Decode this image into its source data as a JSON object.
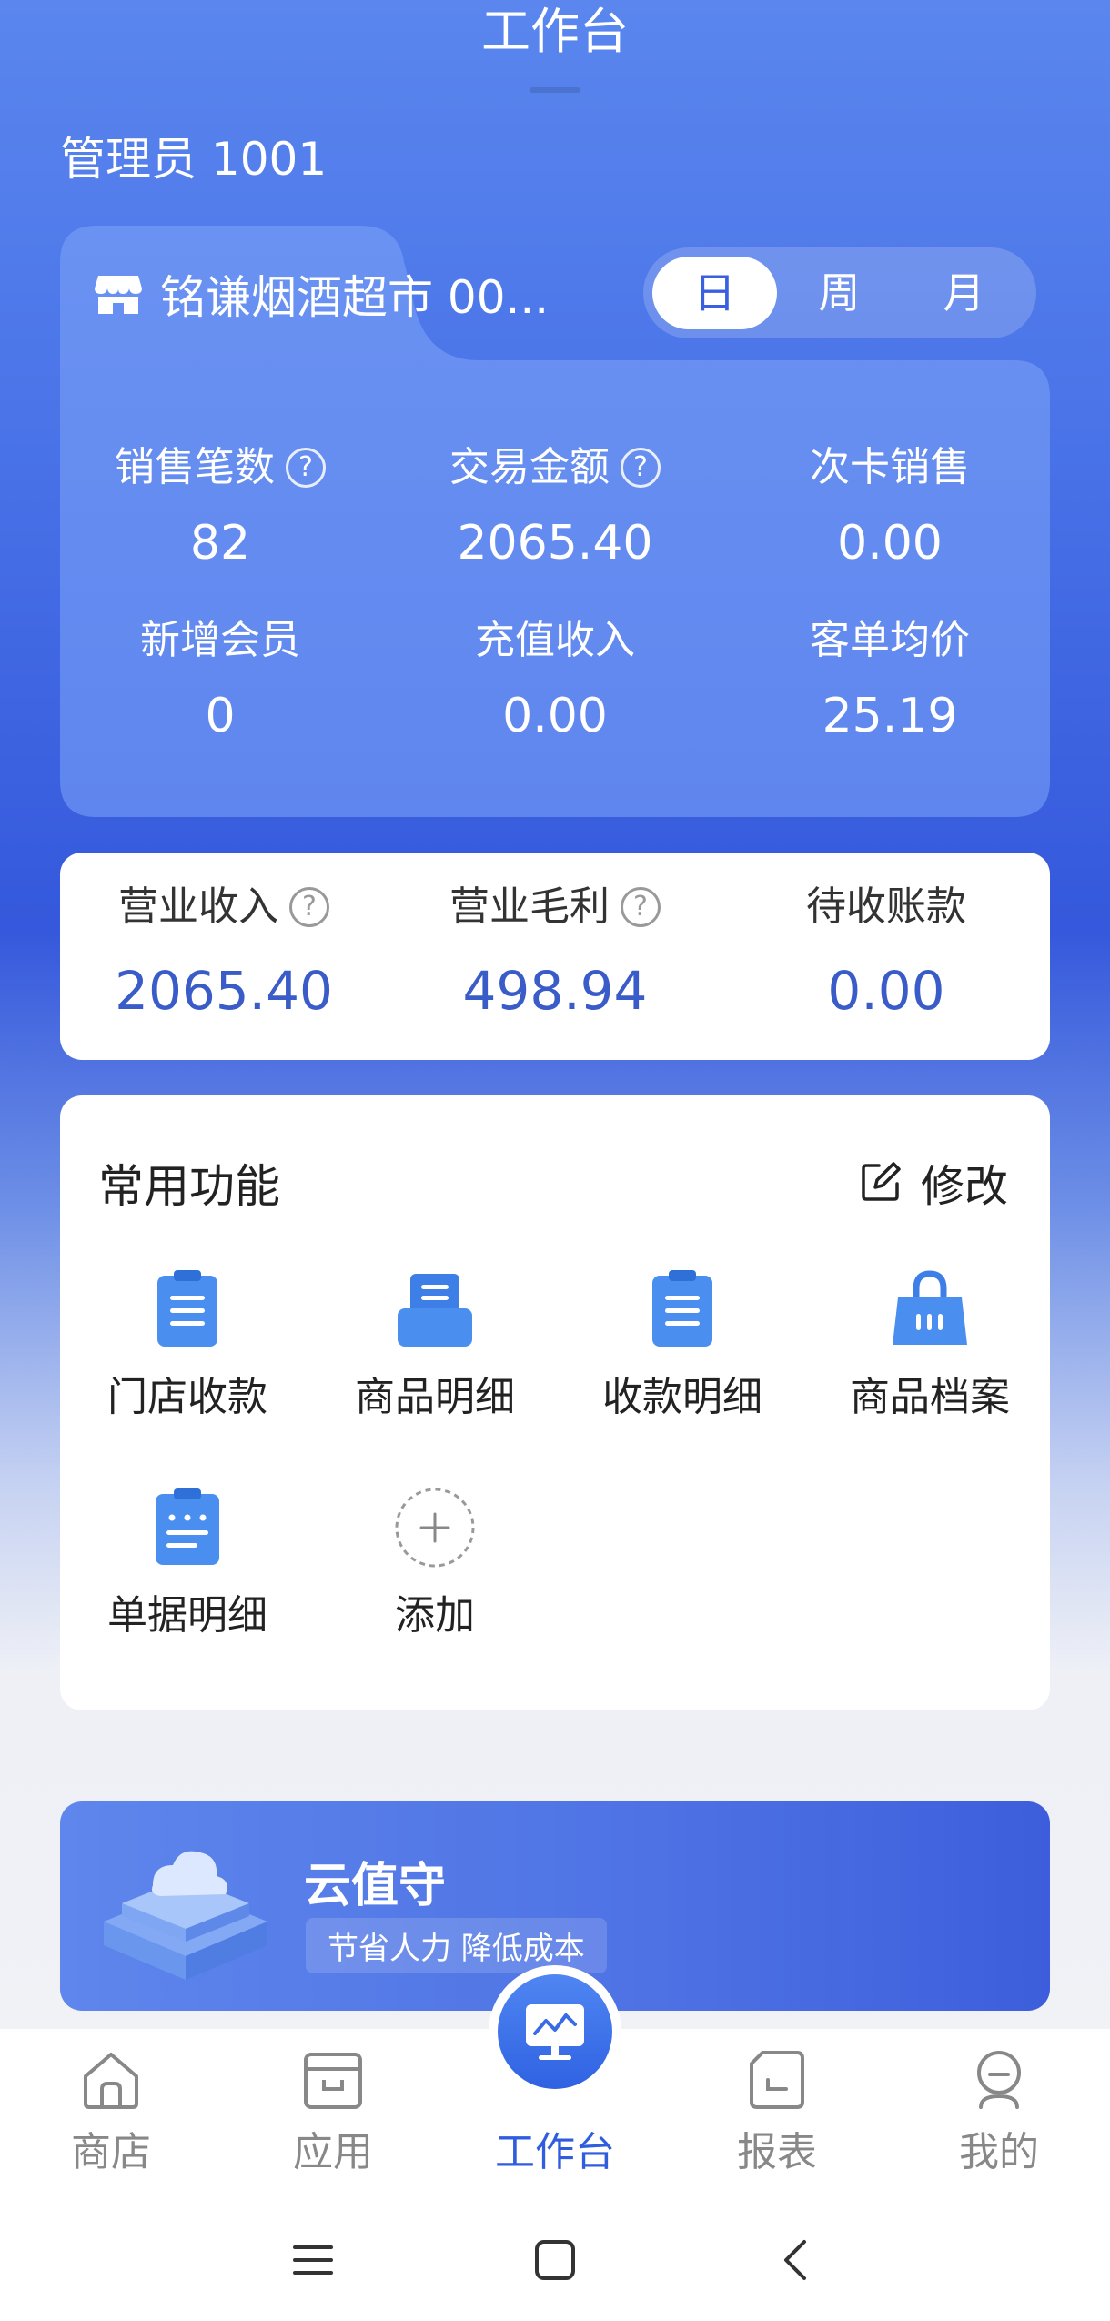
{
  "header": {
    "title": "工作台"
  },
  "user": {
    "label": "管理员  1001"
  },
  "store": {
    "name": "铭谦烟酒超市  00..."
  },
  "period": {
    "options": [
      "日",
      "周",
      "月"
    ],
    "selected": "日"
  },
  "stats": [
    {
      "label": "销售笔数",
      "value": "82",
      "help": true
    },
    {
      "label": "交易金额",
      "value": "2065.40",
      "help": true
    },
    {
      "label": "次卡销售",
      "value": "0.00",
      "help": false
    },
    {
      "label": "新增会员",
      "value": "0",
      "help": false
    },
    {
      "label": "充值收入",
      "value": "0.00",
      "help": false
    },
    {
      "label": "客单均价",
      "value": "25.19",
      "help": false
    }
  ],
  "business": [
    {
      "label": "营业收入",
      "value": "2065.40",
      "help": true
    },
    {
      "label": "营业毛利",
      "value": "498.94",
      "help": true
    },
    {
      "label": "待收账款",
      "value": "0.00",
      "help": false
    }
  ],
  "functions": {
    "title": "常用功能",
    "edit_label": "修改",
    "items": [
      {
        "label": "门店收款",
        "icon": "clipboard-icon"
      },
      {
        "label": "商品明细",
        "icon": "drawer-icon"
      },
      {
        "label": "收款明细",
        "icon": "clipboard-icon"
      },
      {
        "label": "商品档案",
        "icon": "shopping-bag-icon"
      },
      {
        "label": "单据明细",
        "icon": "document-icon"
      },
      {
        "label": "添加",
        "icon": "plus-icon"
      }
    ]
  },
  "banner": {
    "title": "云值守",
    "subtitle": "节省人力 降低成本"
  },
  "nav": {
    "items": [
      {
        "label": "商店",
        "icon": "home-icon"
      },
      {
        "label": "应用",
        "icon": "box-icon"
      },
      {
        "label": "工作台",
        "icon": "monitor-chart-icon",
        "active": true
      },
      {
        "label": "报表",
        "icon": "report-icon"
      },
      {
        "label": "我的",
        "icon": "profile-icon"
      }
    ]
  },
  "colors": {
    "accent": "#2f5dde",
    "value_blue": "#3a5cc8"
  }
}
